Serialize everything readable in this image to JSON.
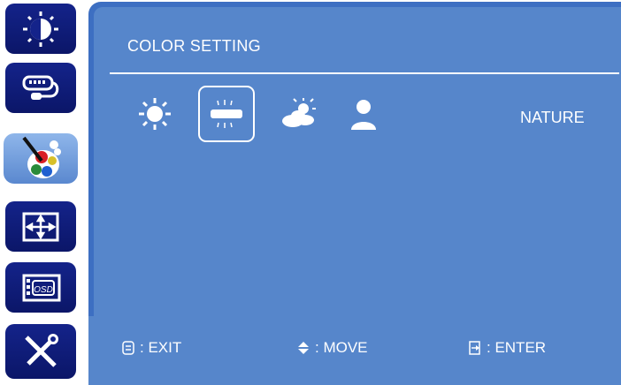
{
  "sidebar": {
    "items": [
      {
        "name": "brightness-contrast",
        "icon": "brightness-contrast-icon"
      },
      {
        "name": "input-source",
        "icon": "input-source-icon"
      },
      {
        "name": "color-setting",
        "icon": "color-palette-icon",
        "active": true
      },
      {
        "name": "image-position",
        "icon": "image-position-icon"
      },
      {
        "name": "osd-setting",
        "icon": "osd-icon"
      },
      {
        "name": "extra-tools",
        "icon": "tools-icon"
      }
    ]
  },
  "panel": {
    "title": "COLOR SETTING",
    "modes": [
      {
        "name": "cool",
        "icon": "sun-icon"
      },
      {
        "name": "nature",
        "icon": "fluorescent-lamp-icon",
        "selected": true
      },
      {
        "name": "warm",
        "icon": "sun-cloud-icon"
      },
      {
        "name": "user",
        "icon": "user-icon"
      }
    ],
    "current_mode": "NATURE"
  },
  "footer": {
    "exit_label": ": EXIT",
    "move_label": ": MOVE",
    "enter_label": ": ENTER"
  },
  "colors": {
    "sidebar_dark": "#0b1668",
    "panel_dark": "#3d6fc2",
    "panel_light": "#5686cb",
    "text": "#ffffff"
  }
}
